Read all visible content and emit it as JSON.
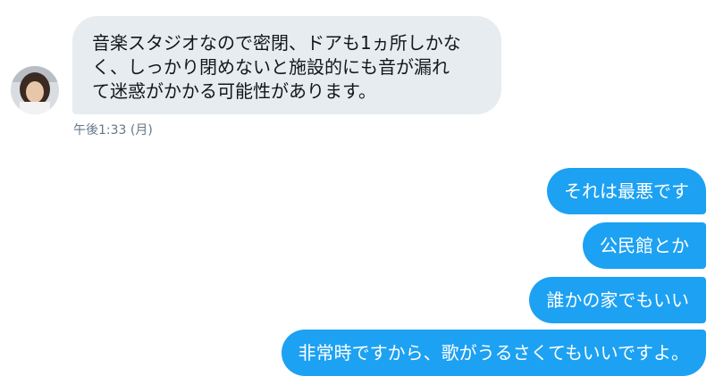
{
  "conversation": {
    "incoming": {
      "text": "音楽スタジオなので密閉、ドアも1ヵ所しかな\nく、しっかり閉めないと施設的にも音が漏れ\nて迷惑がかかる可能性があります。",
      "timestamp": "午後1:33 (月)",
      "bubble_color": "#e6ecf0"
    },
    "outgoing": [
      {
        "text": "それは最悪です"
      },
      {
        "text": "公民館とか"
      },
      {
        "text": "誰かの家でもいい"
      },
      {
        "text": "非常時ですから、歌がうるさくてもいいですよ。"
      }
    ],
    "outgoing_color": "#1da1f2",
    "avatar_icon": "user-photo-avatar"
  }
}
